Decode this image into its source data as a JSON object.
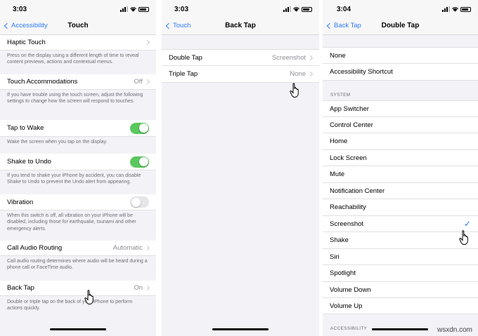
{
  "touch": {
    "time": "3:03",
    "back": "Accessibility",
    "title": "Touch",
    "items": {
      "haptic": {
        "label": "Haptic Touch",
        "desc": "Press on the display using a different length of time to reveal content previews, actions and contextual menus."
      },
      "accom": {
        "label": "Touch Accommodations",
        "value": "Off",
        "desc": "If you have trouble using the touch screen, adjust the following settings to change how the screen will respond to touches."
      },
      "wake": {
        "label": "Tap to Wake",
        "desc": "Wake the screen when you tap on the display."
      },
      "shake": {
        "label": "Shake to Undo",
        "desc": "If you tend to shake your iPhone by accident, you can disable Shake to Undo to prevent the Undo alert from appearing."
      },
      "vibration": {
        "label": "Vibration",
        "desc": "When this switch is off, all vibration on your iPhone will be disabled, including those for earthquake, tsunami and other emergency alerts."
      },
      "audio": {
        "label": "Call Audio Routing",
        "value": "Automatic",
        "desc": "Call audio routing determines where audio will be heard during a phone call or FaceTime audio."
      },
      "backtap": {
        "label": "Back Tap",
        "value": "On",
        "desc": "Double or triple tap on the back of your iPhone to perform actions quickly."
      }
    }
  },
  "backtap": {
    "time": "3:03",
    "back": "Touch",
    "title": "Back Tap",
    "double": {
      "label": "Double Tap",
      "value": "Screenshot"
    },
    "triple": {
      "label": "Triple Tap",
      "value": "None"
    }
  },
  "doubletap": {
    "time": "3:04",
    "back": "Back Tap",
    "title": "Double Tap",
    "top": [
      "None",
      "Accessibility Shortcut"
    ],
    "system_header": "SYSTEM",
    "system": [
      "App Switcher",
      "Control Center",
      "Home",
      "Lock Screen",
      "Mute",
      "Notification Center",
      "Reachability",
      "Screenshot",
      "Shake",
      "Siri",
      "Spotlight",
      "Volume Down",
      "Volume Up"
    ],
    "accessibility_header": "ACCESSIBILITY",
    "checkmark": "✓"
  },
  "watermark": "wsxdn.com",
  "colors": {
    "accent": "#2f7cf6",
    "toggle_on": "#5ac85e",
    "background": "#f2f2f7"
  }
}
